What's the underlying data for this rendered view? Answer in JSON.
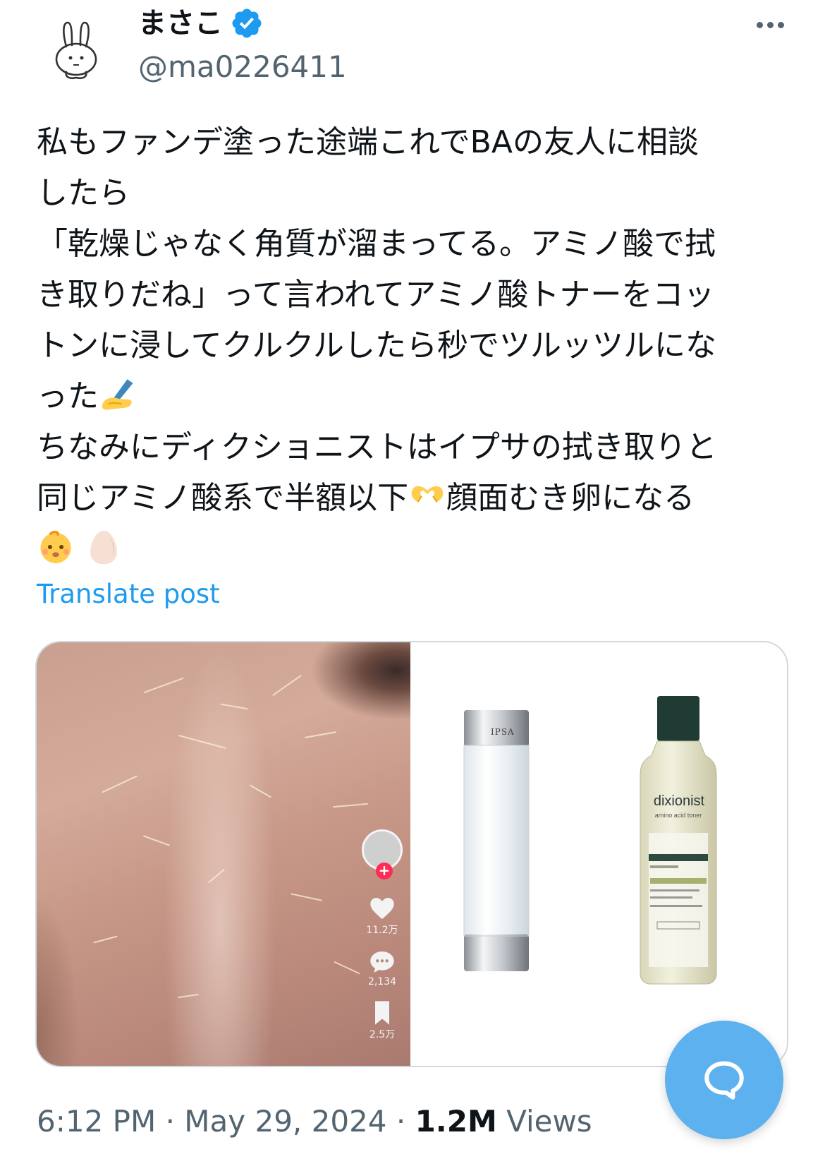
{
  "author": {
    "display_name": "まさこ",
    "handle": "@ma0226411",
    "avatar_icon": "bunny-avatar-icon",
    "verified_icon": "verified-badge-icon",
    "verified_color": "#1d9bf0"
  },
  "tweet": {
    "lines": [
      "私もファンデ塗った途端これでBAの友人に相談",
      "したら",
      "「乾燥じゃなく角質が溜まってる。アミノ酸で拭",
      "き取りだね」って言われてアミノ酸トナーをコッ",
      "トンに浸してクルクルしたら秒でツルッツルにな",
      "った",
      "ちなみにディクショニストはイプサの拭き取りと",
      "同じアミノ酸系で半額以下",
      "顔面むき卵になる"
    ],
    "emojis": [
      "writing-hand-emoji",
      "heart-hands-emoji",
      "baby-emoji",
      "egg-emoji"
    ],
    "translate_label": "Translate post"
  },
  "media": {
    "tiktok": {
      "likes": "11.2万",
      "comments": "2,134",
      "saves": "2.5万"
    },
    "products": {
      "ipsa_label": "IPSA",
      "dixionist_label": "dixionist",
      "dixionist_sub": "amino acid toner"
    }
  },
  "meta": {
    "time": "6:12 PM",
    "sep1": " · ",
    "date": "May 29, 2024",
    "sep2": " · ",
    "views_count": "1.2M",
    "views_label": " Views"
  },
  "fab_icon": "reply-bubble-icon",
  "colors": {
    "link": "#1d9bf0",
    "secondary_text": "#536471",
    "fab": "#5db1ef"
  }
}
